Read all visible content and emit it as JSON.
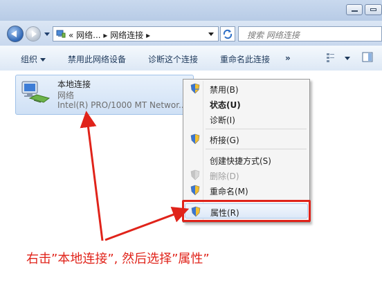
{
  "address": {
    "path": "« 网络... ▸ 网络连接 ▸",
    "search_placeholder": "搜索 网络连接"
  },
  "toolbar": {
    "organize": "组织",
    "disable_device": "禁用此网络设备",
    "diagnose": "诊断这个连接",
    "rename": "重命名此连接",
    "more": "»"
  },
  "connection": {
    "name": "本地连接",
    "network": "网络",
    "adapter": "Intel(R) PRO/1000 MT Networ..."
  },
  "context_menu": {
    "items": [
      {
        "label": "禁用(B)"
      },
      {
        "label": "状态(U)"
      },
      {
        "label": "诊断(I)"
      },
      {
        "label": "桥接(G)"
      },
      {
        "label": "创建快捷方式(S)"
      },
      {
        "label": "删除(D)"
      },
      {
        "label": "重命名(M)"
      },
      {
        "label": "属性(R)"
      }
    ]
  },
  "instruction": "右击”本地连接”, 然后选择”属性”",
  "colors": {
    "annotation_red": "#e0231a",
    "tile_selected": "#cfe0f5",
    "toolbar_text": "#1e395b"
  }
}
